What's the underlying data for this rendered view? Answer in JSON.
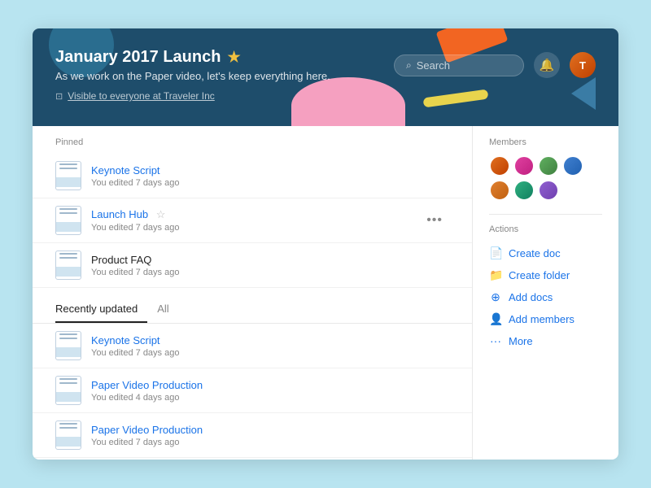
{
  "header": {
    "title": "January 2017 Launch",
    "star": "★",
    "subtitle": "As we work on the Paper video, let's keep everything here.",
    "visibility": "Visible to everyone at Traveler Inc",
    "search_placeholder": "Search",
    "avatar_initials": "T"
  },
  "pinned": {
    "label": "Pinned",
    "items": [
      {
        "title": "Keynote Script",
        "meta": "You edited 7 days ago",
        "link": true,
        "star": false
      },
      {
        "title": "Launch Hub",
        "meta": "You edited 7 days ago",
        "link": true,
        "star": true,
        "more": true
      },
      {
        "title": "Product FAQ",
        "meta": "You edited 7 days ago",
        "link": false,
        "star": false
      }
    ]
  },
  "tabs": [
    {
      "label": "Recently updated",
      "active": true
    },
    {
      "label": "All",
      "active": false
    }
  ],
  "recent_items": [
    {
      "title": "Keynote Script",
      "meta": "You edited 7 days ago"
    },
    {
      "title": "Paper Video Production",
      "meta": "You edited 4 days ago"
    },
    {
      "title": "Paper Video Production",
      "meta": "You edited 7 days ago"
    }
  ],
  "sidebar": {
    "members_label": "Members",
    "actions_label": "Actions",
    "actions": [
      {
        "label": "Create doc",
        "icon": "📄",
        "name": "create-doc"
      },
      {
        "label": "Create folder",
        "icon": "📁",
        "name": "create-folder"
      },
      {
        "label": "Add docs",
        "icon": "➕",
        "name": "add-docs"
      },
      {
        "label": "Add members",
        "icon": "👤",
        "name": "add-members"
      },
      {
        "label": "More",
        "icon": "···",
        "name": "more"
      }
    ]
  },
  "icons": {
    "search": "🔍",
    "bell": "🔔",
    "more_dots": "•••",
    "doc": "📄",
    "folder": "📁",
    "add": "⊕",
    "person": "👤",
    "visibility": "👁"
  }
}
